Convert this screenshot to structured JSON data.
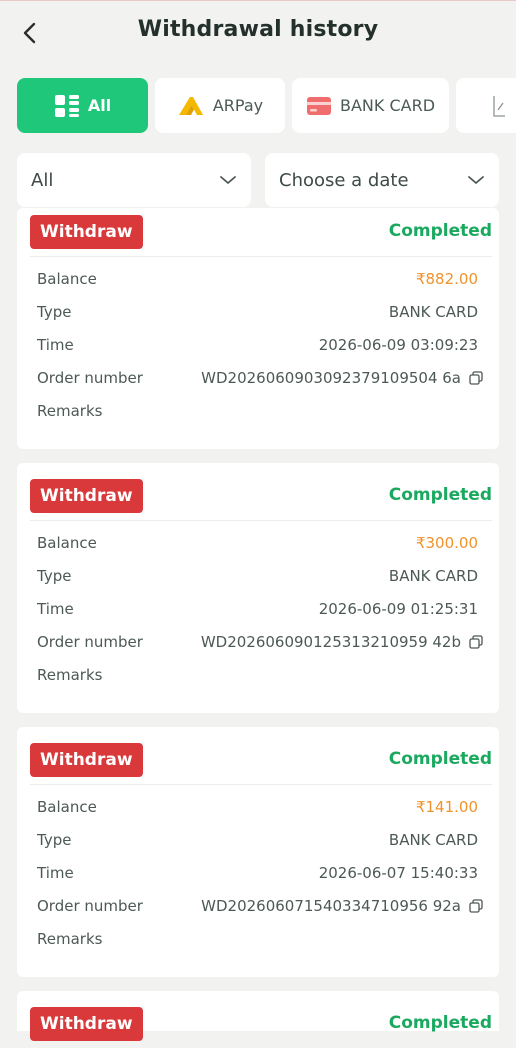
{
  "header": {
    "title": "Withdrawal history"
  },
  "tabs": [
    {
      "label": "All",
      "icon": "grid-icon",
      "active": true
    },
    {
      "label": "ARPay",
      "icon": "arpay-logo-icon",
      "active": false
    },
    {
      "label": "BANK CARD",
      "icon": "bank-card-icon",
      "active": false
    },
    {
      "label": "",
      "icon": "wallet-icon",
      "active": false
    }
  ],
  "filters": {
    "status": {
      "value": "All"
    },
    "date": {
      "placeholder": "Choose a date"
    }
  },
  "labels": {
    "balance": "Balance",
    "type": "Type",
    "time": "Time",
    "order_number": "Order number",
    "remarks": "Remarks"
  },
  "records": [
    {
      "badge": "Withdraw",
      "status": "Completed",
      "balance": "₹882.00",
      "type": "BANK CARD",
      "time": "2026-06-09 03:09:23",
      "order_number": "WD2026060903092379109504 6a",
      "remarks": ""
    },
    {
      "badge": "Withdraw",
      "status": "Completed",
      "balance": "₹300.00",
      "type": "BANK CARD",
      "time": "2026-06-09 01:25:31",
      "order_number": "WD202606090125313210959 42b",
      "remarks": ""
    },
    {
      "badge": "Withdraw",
      "status": "Completed",
      "balance": "₹141.00",
      "type": "BANK CARD",
      "time": "2026-06-07 15:40:33",
      "order_number": "WD202606071540334710956 92a",
      "remarks": ""
    },
    {
      "badge": "Withdraw",
      "status": "Completed"
    }
  ],
  "colors": {
    "accent": "#1ec77a",
    "badge": "#d9393b",
    "completed": "#1aa95f",
    "amount": "#f0932b"
  }
}
